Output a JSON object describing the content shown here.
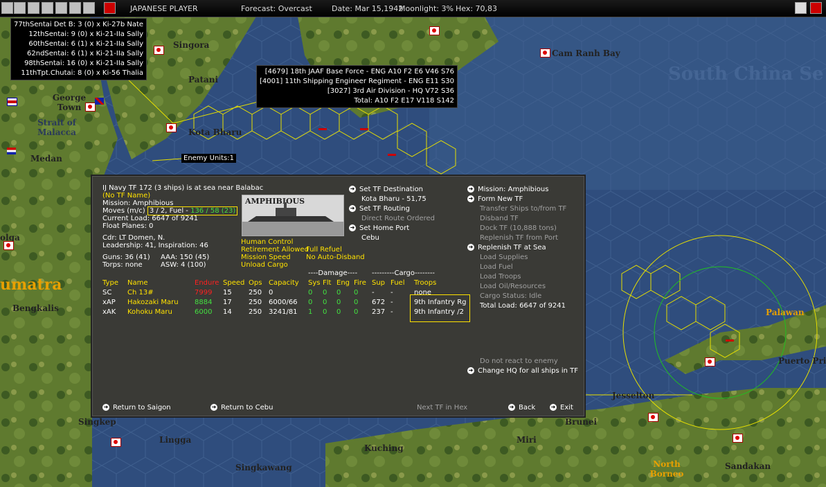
{
  "topbar": {
    "player": "JAPANESE PLAYER",
    "forecast": "Forecast: Overcast",
    "date": "Date: Mar 15,1942",
    "moonlight": "Moonlight: 3%",
    "hex": "Hex: 70,83"
  },
  "map_labels": {
    "singora": "Singora",
    "patani": "Patani",
    "kota_bharu": "Kota Bharu",
    "george_town": "George Town",
    "strait": "Strait of Malacca",
    "medan": "Medan",
    "cam_ranh": "Cam Ranh Bay",
    "south_china": "South China Se",
    "palawan": "Palawan",
    "puerto": "Puerto Prin",
    "jesselton": "Jesselton",
    "brunei": "Brunei",
    "miri": "Miri",
    "north_borneo": "North Borneo",
    "sandakan": "Sandakan",
    "kuching": "Kuching",
    "singkawang": "Singkawang",
    "lingga": "Lingga",
    "singkep": "Singkep",
    "bengkalis": "Bengkalis",
    "sumatra": "umatra",
    "olga": "olga"
  },
  "air_units": [
    "77thSentai Det B: 3 (0) x Ki-27b Nate",
    "12thSentai: 9 (0) x Ki-21-IIa Sally",
    "60thSentai: 6 (1) x Ki-21-IIa Sally",
    "62ndSentai: 6 (1) x Ki-21-IIa Sally",
    "98thSentai: 16 (0) x Ki-21-IIa Sally",
    "11thTpt.Chutai: 8 (0) x Ki-56 Thalia"
  ],
  "ground_units": [
    "[4679] 18th JAAF Base Force - ENG A10 F2 E6 V46 S76",
    "[4001] 11th Shipping Engineer Regiment - ENG E11 S30",
    "[3027] 3rd Air Division - HQ V72 S36",
    "Total: A10 F2 E17 V118 S142"
  ],
  "enemy_units": "Enemy Units:1",
  "tf": {
    "header": "IJ Navy TF 172 (3 ships) is at sea near Balabac",
    "name": "(No TF Name)",
    "mission": "Mission: Amphibious",
    "moves_label": "Moves (m/c)",
    "moves_value": "3 / 2, Fuel -",
    "fuel_value": "136 / 58 (23)",
    "load": "Current Load: 6647 of 9241",
    "float": "Float Planes: 0",
    "cdr": "Cdr: LT  Domen, N.",
    "leadership": "Leadership: 41, Inspiration: 46",
    "guns": "Guns: 36 (41)",
    "aaa": "AAA: 150 (45)",
    "torps": "Torps: none",
    "asw": "ASW: 4 (100)",
    "ship_type_badge": "AMPHIBIOUS",
    "human_control": "Human Control",
    "retirement": "Retirement Allowed",
    "full_refuel": "Full Refuel",
    "mission_speed": "Mission Speed",
    "no_auto": "No Auto-Disband",
    "unload": "Unload Cargo"
  },
  "actions_mid": {
    "set_dest": "Set TF Destination",
    "dest_val": "Kota Bharu - 51,75",
    "set_routing": "Set TF Routing",
    "routing_val": "Direct Route Ordered",
    "set_home": "Set Home Port",
    "home_val": "Cebu"
  },
  "actions_right": {
    "mission": "Mission: Amphibious",
    "form_new": "Form New TF",
    "transfer": "Transfer Ships to/from TF",
    "disband": "Disband TF",
    "dock": "Dock TF (10,888 tons)",
    "replenish_port": "Replenish TF from Port",
    "replenish_sea": "Replenish TF at Sea",
    "load_supplies": "Load Supplies",
    "load_fuel": "Load Fuel",
    "load_troops": "Load Troops",
    "load_oil": "Load Oil/Resources",
    "cargo_status": "Cargo Status: Idle",
    "total_load": "Total Load: 6647 of 9241",
    "no_react": "Do not react to enemy",
    "change_hq": "Change HQ for all ships in TF"
  },
  "table": {
    "headers": [
      "Type",
      "Name",
      "Endure",
      "Speed",
      "Ops",
      "Capacity",
      "Sys",
      "Flt",
      "Eng",
      "Fire",
      "Sup",
      "Fuel",
      "Troops"
    ],
    "damage_header": "----Damage----",
    "cargo_header": "---------Cargo--------",
    "rows": [
      [
        "SC",
        "Ch 13#",
        "7999",
        "15",
        "250",
        "0",
        "0",
        "0",
        "0",
        "0",
        "-",
        "-",
        "none"
      ],
      [
        "xAP",
        "Hakozaki Maru",
        "8884",
        "17",
        "250",
        "6000/66",
        "0",
        "0",
        "0",
        "0",
        "672",
        "-",
        "9th Infantry Rg"
      ],
      [
        "xAK",
        "Kohoku Maru",
        "6000",
        "14",
        "250",
        "3241/81",
        "1",
        "0",
        "0",
        "0",
        "237",
        "-",
        "9th Infantry /2"
      ]
    ]
  },
  "bottom": {
    "return_saigon": "Return to Saigon",
    "return_cebu": "Return to Cebu",
    "next_tf": "Next TF in Hex",
    "back": "Back",
    "exit": "Exit"
  }
}
